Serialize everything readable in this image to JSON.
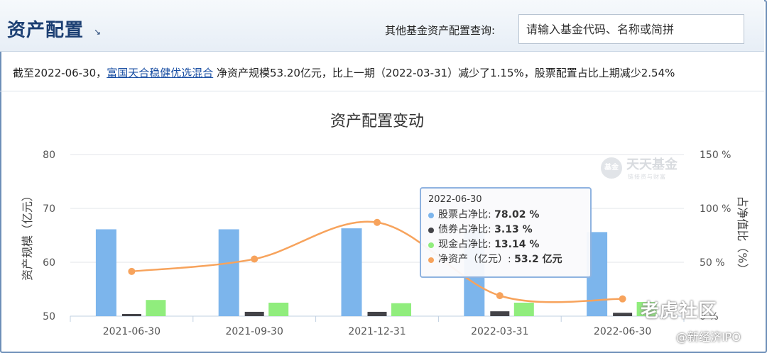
{
  "header": {
    "title": "资产配置",
    "title_arrow": "↘",
    "query_label": "其他基金资产配置查询:",
    "query_placeholder": "请输入基金代码、名称或简拼"
  },
  "summary": {
    "prefix": "截至2022-06-30，",
    "fund_link": "富国天合稳健优选混合",
    "suffix": " 净资产规模53.20亿元，比上一期（2022-03-31）减少了1.15%，股票配置占比上期减少2.54%"
  },
  "chart_data": {
    "type": "bar",
    "title": "资产配置变动",
    "categories": [
      "2021-06-30",
      "2021-09-30",
      "2021-12-31",
      "2022-03-31",
      "2022-06-30"
    ],
    "ylabel": "资产规模（亿元）",
    "ylabel_right": "占净值比（%）",
    "ylim": [
      50,
      80
    ],
    "yticks": [
      "80",
      "70",
      "60",
      "50"
    ],
    "ylim_right": [
      0,
      150
    ],
    "yticks_right": [
      "150 %",
      "100 %",
      "50 %",
      "0 %"
    ],
    "series": [
      {
        "name": "股票占净比",
        "axis": "right",
        "type": "bar",
        "color": "#7cb5ec",
        "values": [
          80.6,
          80.6,
          81.5,
          80.5,
          78.02
        ]
      },
      {
        "name": "债券占净比",
        "axis": "right",
        "type": "bar",
        "color": "#434348",
        "values": [
          2.0,
          4.0,
          4.0,
          4.5,
          3.13
        ]
      },
      {
        "name": "现金占净比",
        "axis": "right",
        "type": "bar",
        "color": "#90ed7d",
        "values": [
          15.0,
          12.5,
          12.0,
          12.5,
          13.14
        ]
      },
      {
        "name": "净资产（亿元）",
        "axis": "left",
        "type": "line",
        "color": "#f7a35c",
        "values": [
          58.3,
          60.6,
          67.4,
          53.8,
          53.2
        ]
      }
    ],
    "grid": true
  },
  "tooltip": {
    "date": "2022-06-30",
    "rows": [
      {
        "label": "股票占净比: ",
        "value": "78.02 %",
        "color": "#7cb5ec"
      },
      {
        "label": "债券占净比: ",
        "value": "3.13 %",
        "color": "#434348"
      },
      {
        "label": "现金占净比: ",
        "value": "13.14 %",
        "color": "#90ed7d"
      },
      {
        "label": "净资产（亿元）: ",
        "value": "53.2 亿元",
        "color": "#f7a35c"
      }
    ]
  },
  "watermarks": {
    "brand_logo": "基金",
    "brand_name": "天天基金",
    "brand_slogan": "链接资与财富",
    "community": "老虎社区",
    "account": "@新经济IPO"
  }
}
